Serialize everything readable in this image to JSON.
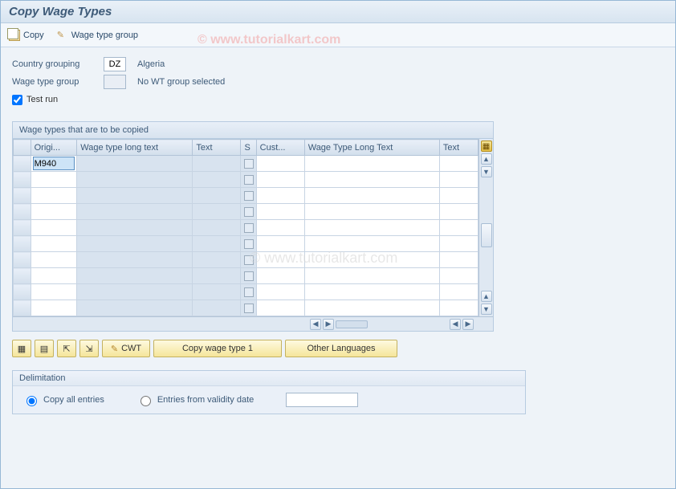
{
  "title": "Copy Wage Types",
  "watermark": "© www.tutorialkart.com",
  "toolbar": {
    "copy_label": "Copy",
    "wage_type_group_label": "Wage type group"
  },
  "fields": {
    "country_grouping_label": "Country grouping",
    "country_grouping_value": "DZ",
    "country_grouping_desc": "Algeria",
    "wage_type_group_label": "Wage type group",
    "wage_type_group_value": "",
    "wage_type_group_desc": "No WT group selected",
    "test_run_label": "Test run",
    "test_run_checked": true
  },
  "table": {
    "title": "Wage types that are to be copied",
    "columns": [
      "Origi...",
      "Wage type long text",
      "Text",
      "S",
      "Cust...",
      "Wage Type Long Text",
      "Text"
    ],
    "rows": [
      {
        "orig": "M940",
        "long1": "",
        "text1": "",
        "s": "",
        "cust": "",
        "long2": "",
        "text2": ""
      },
      {
        "orig": "",
        "long1": "",
        "text1": "",
        "s": "",
        "cust": "",
        "long2": "",
        "text2": ""
      },
      {
        "orig": "",
        "long1": "",
        "text1": "",
        "s": "",
        "cust": "",
        "long2": "",
        "text2": ""
      },
      {
        "orig": "",
        "long1": "",
        "text1": "",
        "s": "",
        "cust": "",
        "long2": "",
        "text2": ""
      },
      {
        "orig": "",
        "long1": "",
        "text1": "",
        "s": "",
        "cust": "",
        "long2": "",
        "text2": ""
      },
      {
        "orig": "",
        "long1": "",
        "text1": "",
        "s": "",
        "cust": "",
        "long2": "",
        "text2": ""
      },
      {
        "orig": "",
        "long1": "",
        "text1": "",
        "s": "",
        "cust": "",
        "long2": "",
        "text2": ""
      },
      {
        "orig": "",
        "long1": "",
        "text1": "",
        "s": "",
        "cust": "",
        "long2": "",
        "text2": ""
      },
      {
        "orig": "",
        "long1": "",
        "text1": "",
        "s": "",
        "cust": "",
        "long2": "",
        "text2": ""
      },
      {
        "orig": "",
        "long1": "",
        "text1": "",
        "s": "",
        "cust": "",
        "long2": "",
        "text2": ""
      }
    ]
  },
  "actions": {
    "cwt_label": "CWT",
    "copy_wt1_label": "Copy wage type 1",
    "other_langs_label": "Other Languages"
  },
  "delimitation": {
    "title": "Delimitation",
    "opt_copy_all": "Copy all entries",
    "opt_entries_from": "Entries from validity date",
    "date_value": ""
  },
  "icons": {
    "select_all": "▤",
    "deselect_all": "▥",
    "first": "⇤",
    "last": "⇥",
    "pencil": "✎"
  }
}
